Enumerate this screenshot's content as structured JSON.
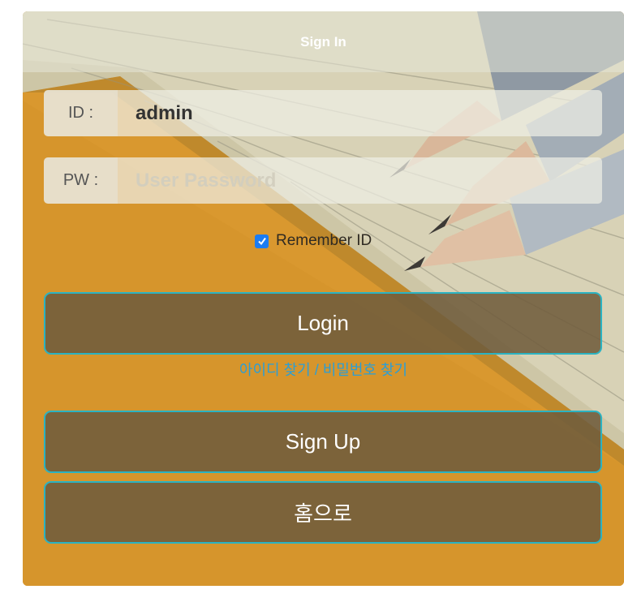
{
  "header": {
    "title": "Sign In"
  },
  "form": {
    "id_label": "ID :",
    "id_value": "admin",
    "pw_label": "PW :",
    "pw_placeholder": "User Password",
    "remember_label": "Remember ID",
    "remember_checked": true
  },
  "actions": {
    "login_label": "Login",
    "find_link": "아이디 찾기 / 비밀번호 찾기",
    "signup_label": "Sign Up",
    "home_label": "홈으로"
  },
  "colors": {
    "accent_border": "#2bb3c2",
    "link": "#2b9ed6",
    "checkbox": "#1b7cf2"
  },
  "icons": {
    "checkbox_check": "checkmark-icon"
  }
}
